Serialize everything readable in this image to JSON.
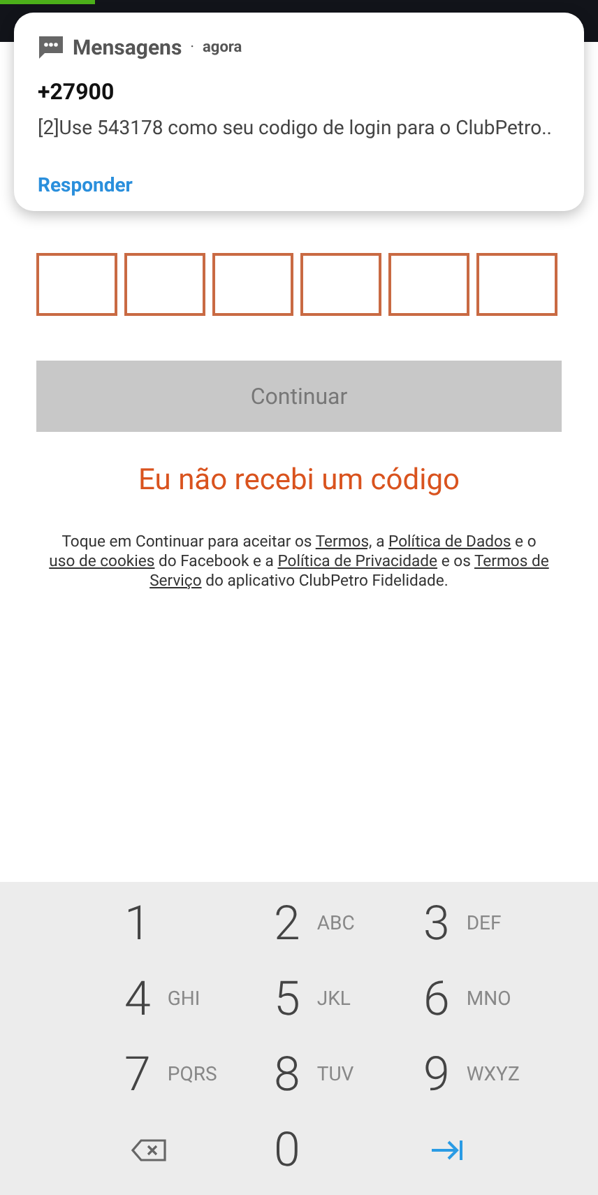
{
  "status_bar": {
    "progress": {
      "level": 0.16
    }
  },
  "notification": {
    "app": "Mensagens",
    "separator": "·",
    "time": "agora",
    "sender": "+27900",
    "message": "[2]Use 543178 como seu codigo de login para o ClubPetro..",
    "action": "Responder"
  },
  "code_fields": [
    {
      "kind": "digit"
    },
    {
      "kind": "digit"
    },
    {
      "kind": "digit"
    },
    {
      "kind": "digit"
    },
    {
      "kind": "digit"
    },
    {
      "kind": "digit"
    }
  ],
  "continue_button": {
    "label": "Continuar",
    "disabled": true
  },
  "resend_link": "Eu não recebi um código",
  "terms": [
    {
      "kind": "text",
      "text": "Toque em Continuar para aceitar os "
    },
    {
      "kind": "link",
      "text": "Termos,"
    },
    {
      "kind": "text",
      "text": " a "
    },
    {
      "kind": "link",
      "text": "Política de Dados"
    },
    {
      "kind": "text",
      "text": " e o "
    },
    {
      "kind": "link",
      "text": "uso de cookies"
    },
    {
      "kind": "text",
      "text": " do Facebook e a "
    },
    {
      "kind": "link",
      "text": "Política de Privacidade"
    },
    {
      "kind": "text",
      "text": " e os "
    },
    {
      "kind": "link",
      "text": "Termos de"
    },
    {
      "kind": "link",
      "text": "Serviço"
    },
    {
      "kind": "text",
      "text": " do aplicativo ClubPetro Fidelidade."
    }
  ],
  "keypad": [
    {
      "kind": "digit",
      "digit": "1"
    },
    {
      "kind": "digit",
      "digit": "2",
      "letters": "ABC"
    },
    {
      "kind": "digit",
      "digit": "3",
      "letters": "DEF"
    },
    {
      "kind": "digit",
      "digit": "4",
      "letters": "GHI"
    },
    {
      "kind": "digit",
      "digit": "5",
      "letters": "JKL"
    },
    {
      "kind": "digit",
      "digit": "6",
      "letters": "MNO"
    },
    {
      "kind": "digit",
      "digit": "7",
      "letters": "PQRS"
    },
    {
      "kind": "digit",
      "digit": "8",
      "letters": "TUV"
    },
    {
      "kind": "digit",
      "digit": "9",
      "letters": "WXYZ"
    },
    {
      "kind": "backspace"
    },
    {
      "kind": "digit",
      "digit": "0"
    },
    {
      "kind": "next"
    }
  ]
}
